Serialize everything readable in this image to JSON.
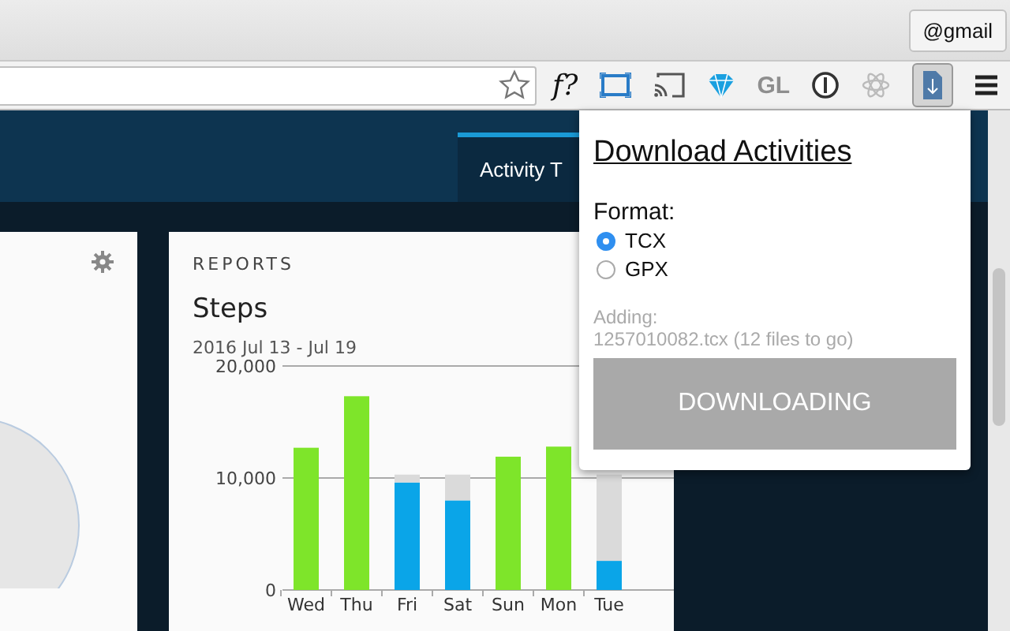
{
  "browser": {
    "account": "@gmail",
    "extension_labels": [
      "f?",
      "GL"
    ]
  },
  "header": {
    "tabs": [
      {
        "label": "Activity T",
        "selected": true
      }
    ]
  },
  "reports": {
    "section": "REPORTS",
    "title": "Steps",
    "range": "2016 Jul 13 - Jul 19",
    "chart_data": {
      "type": "bar",
      "stacked": true,
      "categories": [
        "Wed",
        "Thu",
        "Fri",
        "Sat",
        "Sun",
        "Mon",
        "Tue"
      ],
      "ylim": [
        0,
        20000
      ],
      "yticks": [
        {
          "value": 0,
          "label": "0"
        },
        {
          "value": 10000,
          "label": "10,000"
        },
        {
          "value": 20000,
          "label": "20,000"
        }
      ],
      "series": [
        {
          "color": "#7ee52a",
          "values": [
            12700,
            17300,
            null,
            null,
            11900,
            12800,
            null
          ]
        },
        {
          "color": "#0aa5e8",
          "values": [
            null,
            null,
            9600,
            8000,
            null,
            null,
            2600
          ]
        },
        {
          "color": "#dadada",
          "values": [
            null,
            null,
            700,
            2300,
            null,
            null,
            7700
          ]
        }
      ]
    }
  },
  "popup": {
    "title": "Download Activities",
    "format_label": "Format:",
    "formats": [
      {
        "label": "TCX",
        "selected": true
      },
      {
        "label": "GPX",
        "selected": false
      }
    ],
    "status_label": "Adding:",
    "status_file": "1257010082.tcx (12 files to go)",
    "button": {
      "label": "DOWNLOADING",
      "disabled": true
    }
  }
}
